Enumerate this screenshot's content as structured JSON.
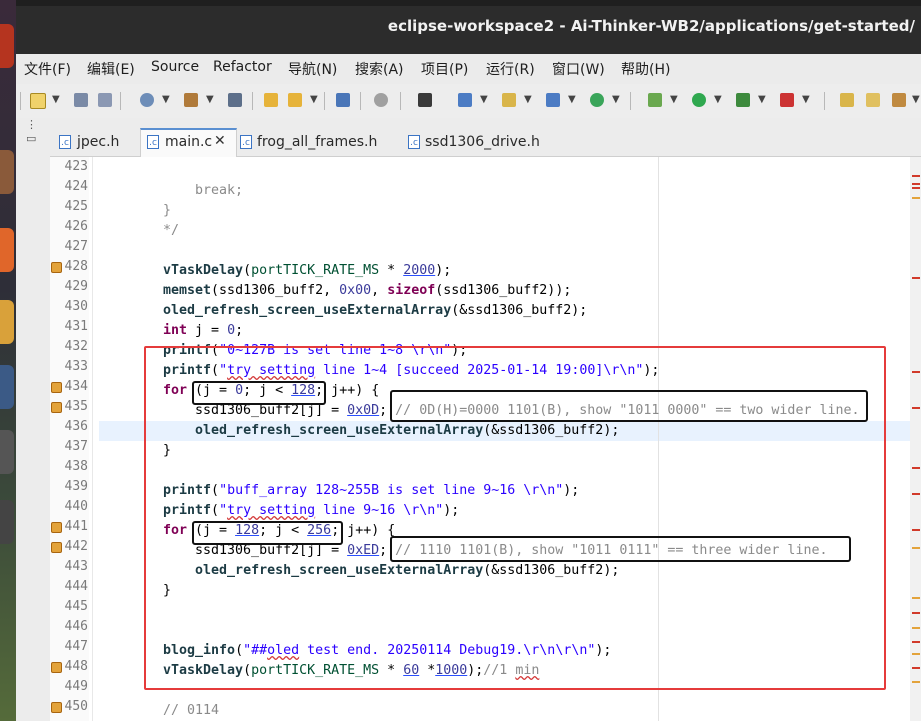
{
  "window": {
    "title": "eclipse-workspace2 - Ai-Thinker-WB2/applications/get-started/",
    "close_fragment": "}"
  },
  "menu": [
    "文件(F)",
    "编辑(E)",
    "Source",
    "Refactor",
    "导航(N)",
    "搜索(A)",
    "项目(P)",
    "运行(R)",
    "窗口(W)",
    "帮助(H)"
  ],
  "tabs": [
    {
      "label": "jpec.h",
      "active": false
    },
    {
      "label": "main.c",
      "active": true,
      "close": "✕"
    },
    {
      "label": "frog_all_frames.h",
      "active": false
    },
    {
      "label": "ssd1306_drive.h",
      "active": false
    }
  ],
  "tab_icon_letter": ".c",
  "side_icons": [
    "⋮",
    "▭"
  ],
  "line_numbers": [
    "423",
    "424",
    "425",
    "426",
    "427",
    "428",
    "429",
    "430",
    "431",
    "432",
    "433",
    "434",
    "435",
    "436",
    "437",
    "438",
    "439",
    "440",
    "441",
    "442",
    "443",
    "444",
    "445",
    "446",
    "447",
    "448",
    "449",
    "450"
  ],
  "marked_lines": [
    428,
    434,
    435,
    441,
    442,
    448,
    450
  ],
  "colors": {
    "keyword": "#7f0055",
    "string": "#2a00ff",
    "comment": "#8a8a8a",
    "highlight_box": "#e53b3b",
    "accent_tab": "#5a8fd1",
    "marker": "#e3a33b"
  }
}
